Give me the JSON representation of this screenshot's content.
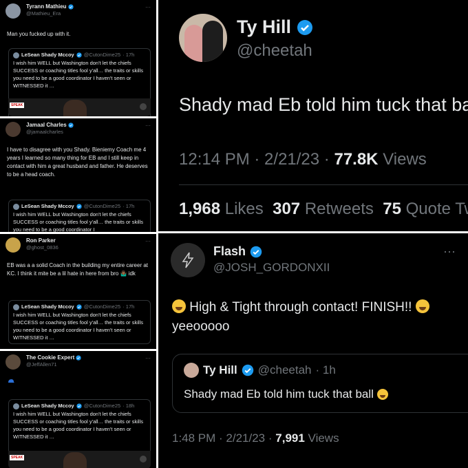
{
  "colors": {
    "background": "#000000",
    "text": "#e7e9ea",
    "muted": "#71767b",
    "verified": "#1d9bf0",
    "border": "#2f3336"
  },
  "panel1": {
    "name": "Tyrann Mathieu",
    "handle": "@Mathieu_Era",
    "more": "···",
    "text": "Man you fucked up with it.",
    "quote": {
      "name": "LeSean Shady Mccoy",
      "handle": "@CutonDime25",
      "time": "· 17h",
      "text": "I wish him WELL but Washington don't let the chiefs SUCCESS or coaching titles fool y'all… the traits or skills you need to be a good coordinator I haven't seen or WITNESSED it …"
    },
    "media_badge": "SPEAK"
  },
  "panel2": {
    "name": "Jamaal Charles",
    "handle": "@jamaalcharles",
    "more": "···",
    "text": "I have to disagree with you Shady. Bieniemy Coach me 4 years I learned so many thing for EB and I still keep in contact with him a great husband and father. He deserves to be a head coach.",
    "quote": {
      "name": "LeSean Shady Mccoy",
      "handle": "@CutonDime25",
      "time": "· 17h",
      "text": "I wish him WELL but Washington don't let the chiefs SUCCESS or coaching titles fool y'all… the traits or skills you need to be a good coordinator I"
    }
  },
  "panel3": {
    "name": "Ron Parker",
    "handle": "@ghost_0836",
    "more": "···",
    "text": "EB was a a solid Coach in the building my entire career at KC. I think it mite be a lil hate in here from bro 🤷🏾‍♂️ idk",
    "quote": {
      "name": "LeSean Shady Mccoy",
      "handle": "@CutonDime25",
      "time": "· 17h",
      "text": "I wish him WELL but Washington don't let the chiefs SUCCESS or coaching titles fool y'all… the traits or skills you need to be a good coordinator I haven't seen or WITNESSED it …"
    }
  },
  "panel4": {
    "name": "The Cookie Expert",
    "handle": "@JeffAllen71",
    "more": "···",
    "quote": {
      "name": "LeSean Shady Mccoy",
      "handle": "@CutonDime25",
      "time": "· 18h",
      "text": "I wish him WELL but Washington don't let the chiefs SUCCESS or coaching titles fool y'all… the traits or skills you need to be a good coordinator I haven't seen or WITNESSED it …"
    },
    "media_badge": "SPEAK"
  },
  "panel5": {
    "name": "Ty Hill",
    "handle": "@cheetah",
    "text": "Shady mad Eb told him tuck that ball",
    "time": "12:14 PM · 2/21/23 ·",
    "views_count": "77.8K",
    "views_label": "Views",
    "likes_count": "1,968",
    "likes_label": "Likes",
    "retweets_count": "307",
    "retweets_label": "Retweets",
    "quotes_count": "75",
    "quotes_label": "Quote Tweets"
  },
  "panel6": {
    "name": "Flash",
    "handle": "@JOSH_GORDONXII",
    "more": "···",
    "text_part1": "High & Tight through contact! FINISH!!",
    "text_part2": "yeeooooo",
    "quote": {
      "name": "Ty Hill",
      "handle": "@cheetah",
      "time": "· 1h",
      "text": "Shady mad Eb told him tuck that ball"
    },
    "time": "1:48 PM · 2/21/23 ·",
    "views_count": "7,991",
    "views_label": "Views"
  }
}
